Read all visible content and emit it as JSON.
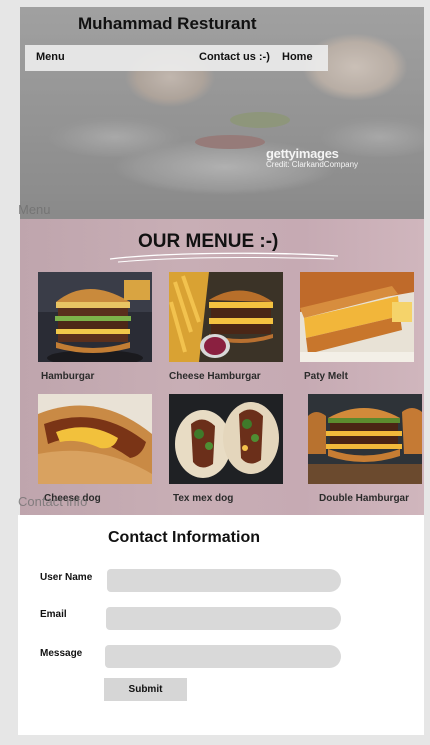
{
  "brand": {
    "title": "Muhammad Resturant"
  },
  "nav": {
    "menu": "Menu",
    "contact": "Contact us :-)",
    "home": "Home"
  },
  "hero": {
    "watermark": "gettyimages",
    "credit": "Credit: ClarkandCompany"
  },
  "section_tags": {
    "menu": "Menu",
    "contact": "Contact info"
  },
  "menu": {
    "heading": "OUR MENUE :-)",
    "items": [
      {
        "label": "Hamburgar"
      },
      {
        "label": "Cheese Hamburgar"
      },
      {
        "label": "Paty Melt"
      },
      {
        "label": "Cheese dog"
      },
      {
        "label": "Tex mex dog"
      },
      {
        "label": "Double Hamburgar"
      }
    ]
  },
  "contact": {
    "title": "Contact Information",
    "user_name_label": "User Name",
    "email_label": "Email",
    "message_label": "Message",
    "user_name_value": "",
    "email_value": "",
    "message_value": "",
    "submit_label": "Submit"
  },
  "colors": {
    "menu_bg": "#c6aab3",
    "input_bg": "#d9d9d9",
    "page_bg": "#e6e6e6"
  }
}
